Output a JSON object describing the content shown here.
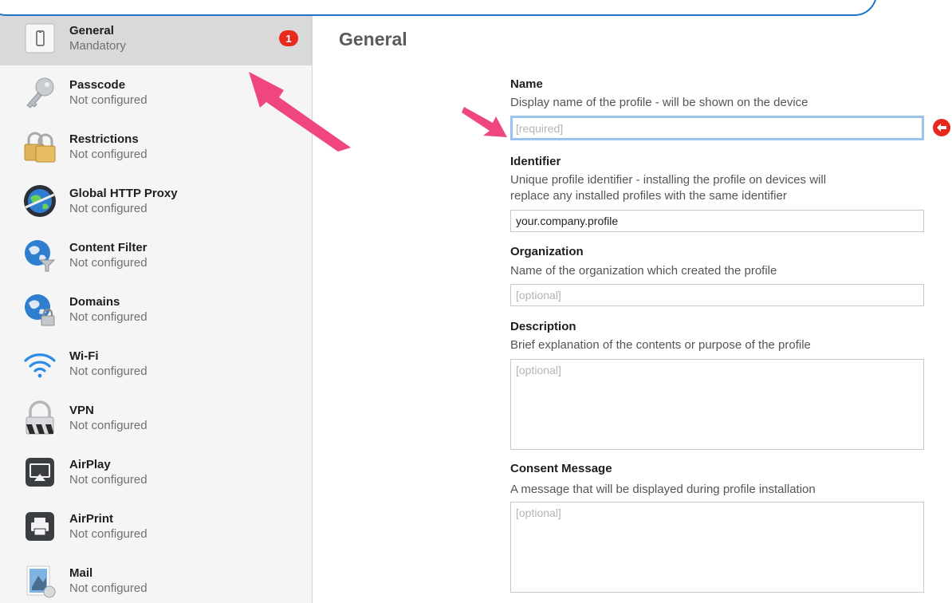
{
  "sidebar": {
    "items": [
      {
        "title": "General",
        "status": "Mandatory",
        "badge": "1",
        "icon": "phone-icon"
      },
      {
        "title": "Passcode",
        "status": "Not configured",
        "icon": "key-icon"
      },
      {
        "title": "Restrictions",
        "status": "Not configured",
        "icon": "padlocks-icon"
      },
      {
        "title": "Global HTTP Proxy",
        "status": "Not configured",
        "icon": "globe-proxy-icon"
      },
      {
        "title": "Content Filter",
        "status": "Not configured",
        "icon": "globe-filter-icon"
      },
      {
        "title": "Domains",
        "status": "Not configured",
        "icon": "globe-lock-icon"
      },
      {
        "title": "Wi-Fi",
        "status": "Not configured",
        "icon": "wifi-icon"
      },
      {
        "title": "VPN",
        "status": "Not configured",
        "icon": "vpn-lock-icon"
      },
      {
        "title": "AirPlay",
        "status": "Not configured",
        "icon": "airplay-icon"
      },
      {
        "title": "AirPrint",
        "status": "Not configured",
        "icon": "printer-icon"
      },
      {
        "title": "Mail",
        "status": "Not configured",
        "icon": "mail-stamp-icon"
      }
    ]
  },
  "main": {
    "title": "General",
    "fields": {
      "name": {
        "label": "Name",
        "description": "Display name of the profile - will be shown on the device",
        "value": "",
        "placeholder": "[required]"
      },
      "identifier": {
        "label": "Identifier",
        "description_line1": "Unique profile identifier - installing the profile on devices will",
        "description_line2": "replace any installed profiles with the same identifier",
        "value": "your.company.profile",
        "placeholder": ""
      },
      "organization": {
        "label": "Organization",
        "description": "Name of the organization which created the profile",
        "value": "",
        "placeholder": "[optional]"
      },
      "description": {
        "label": "Description",
        "description": "Brief explanation of the contents or purpose of the profile",
        "value": "",
        "placeholder": "[optional]"
      },
      "consent": {
        "label": "Consent Message",
        "description": "A message that will be displayed during profile installation",
        "value": "",
        "placeholder": "[optional]"
      }
    }
  },
  "colors": {
    "accent_arrow": "#f0467e",
    "badge": "#e8291d",
    "focus_ring": "#9cc3ee",
    "callout_border": "#1b72c6"
  }
}
